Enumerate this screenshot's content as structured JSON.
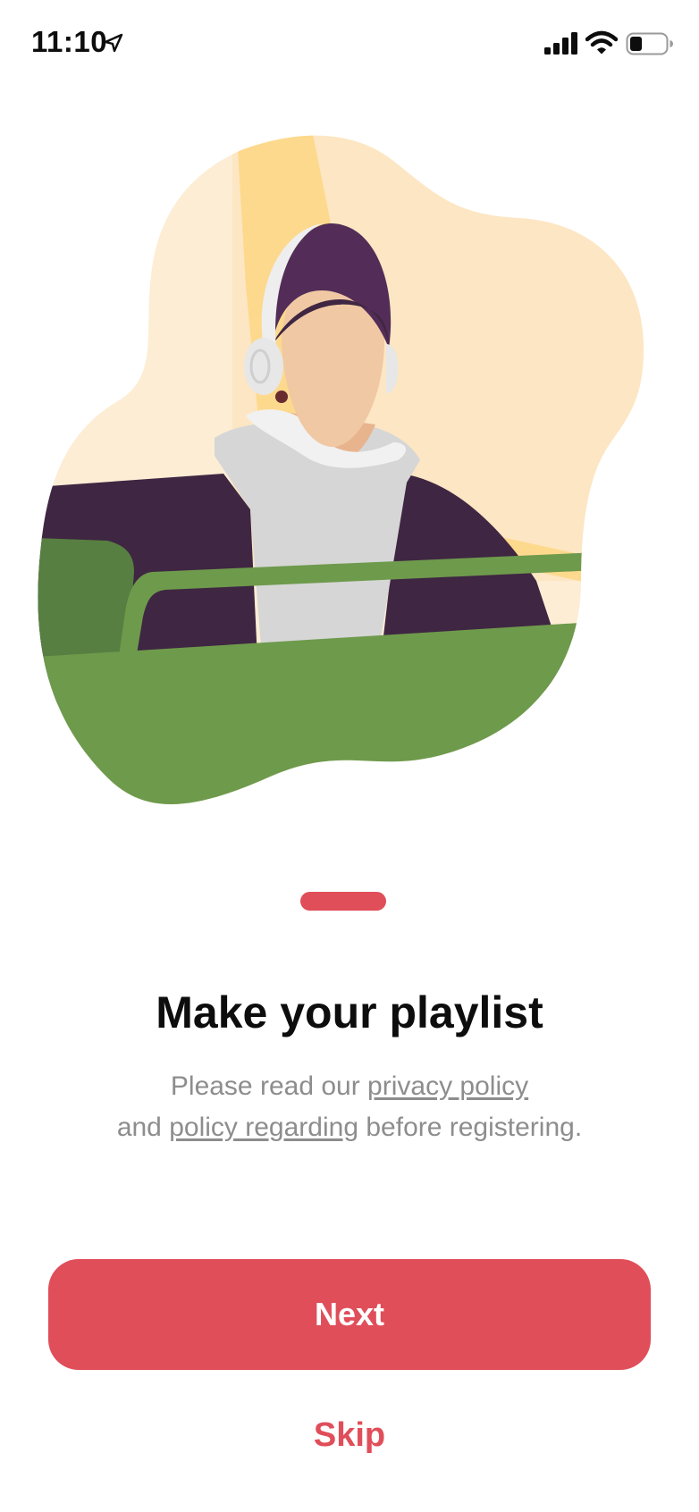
{
  "status_bar": {
    "time": "11:10",
    "icons": [
      "location-arrow-icon",
      "cellular-signal-icon",
      "wifi-icon",
      "battery-icon"
    ]
  },
  "onboarding": {
    "illustration": "person-with-headphones-illustration",
    "page_indicator": {
      "current": 1
    },
    "title": "Make your playlist",
    "description": {
      "part1": "Please read our",
      "link1": "privacy policy",
      "part2": "and",
      "link2": "policy regarding",
      "part3": "before registering."
    }
  },
  "actions": {
    "next_label": "Next",
    "skip_label": "Skip"
  },
  "colors": {
    "accent": "#e04e59",
    "text_primary": "#0d0d0d",
    "text_secondary": "#8d8d8d",
    "background": "#ffffff"
  }
}
